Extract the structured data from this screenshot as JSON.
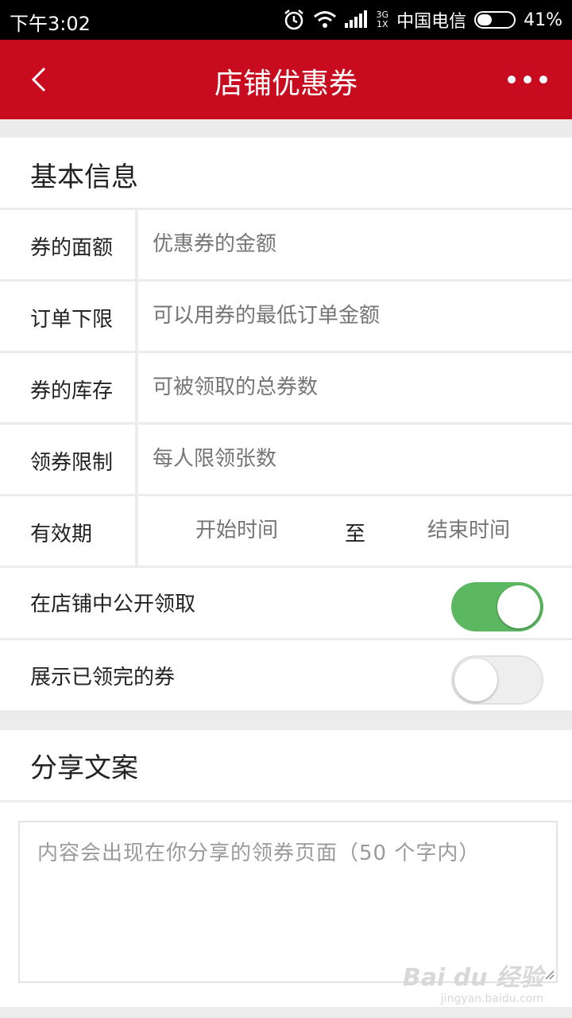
{
  "status_bar": {
    "time": "下午3:02",
    "network_top": "3G",
    "network_bottom": "1X",
    "carrier": "中国电信",
    "battery": "41%",
    "battery_level": 0.41,
    "icons": [
      "alarm-icon",
      "wifi-icon",
      "signal-icon",
      "battery-icon"
    ]
  },
  "header": {
    "title": "店铺优惠券",
    "back_icon": "chevron-left-icon",
    "more_icon": "more-dots-icon",
    "background_color": "#c80b1e"
  },
  "basic_info": {
    "title": "基本信息",
    "fields": [
      {
        "label": "券的面额",
        "placeholder": "优惠券的金额",
        "value": ""
      },
      {
        "label": "订单下限",
        "placeholder": "可以用券的最低订单金额",
        "value": ""
      },
      {
        "label": "券的库存",
        "placeholder": "可被领取的总券数",
        "value": ""
      },
      {
        "label": "领券限制",
        "placeholder": "每人限领张数",
        "value": ""
      }
    ],
    "validity": {
      "label": "有效期",
      "start_placeholder": "开始时间",
      "separator": "至",
      "end_placeholder": "结束时间"
    }
  },
  "toggles": [
    {
      "label": "在店铺中公开领取",
      "on": true,
      "on_color": "#5cb860"
    },
    {
      "label": "展示已领完的券",
      "on": false,
      "off_color": "#eeeeee"
    }
  ],
  "share": {
    "title": "分享文案",
    "placeholder": "内容会出现在你分享的领券页面（50 个字内）"
  },
  "watermark": {
    "logo": "Bai du 经验",
    "url": "jingyan.baidu.com"
  }
}
